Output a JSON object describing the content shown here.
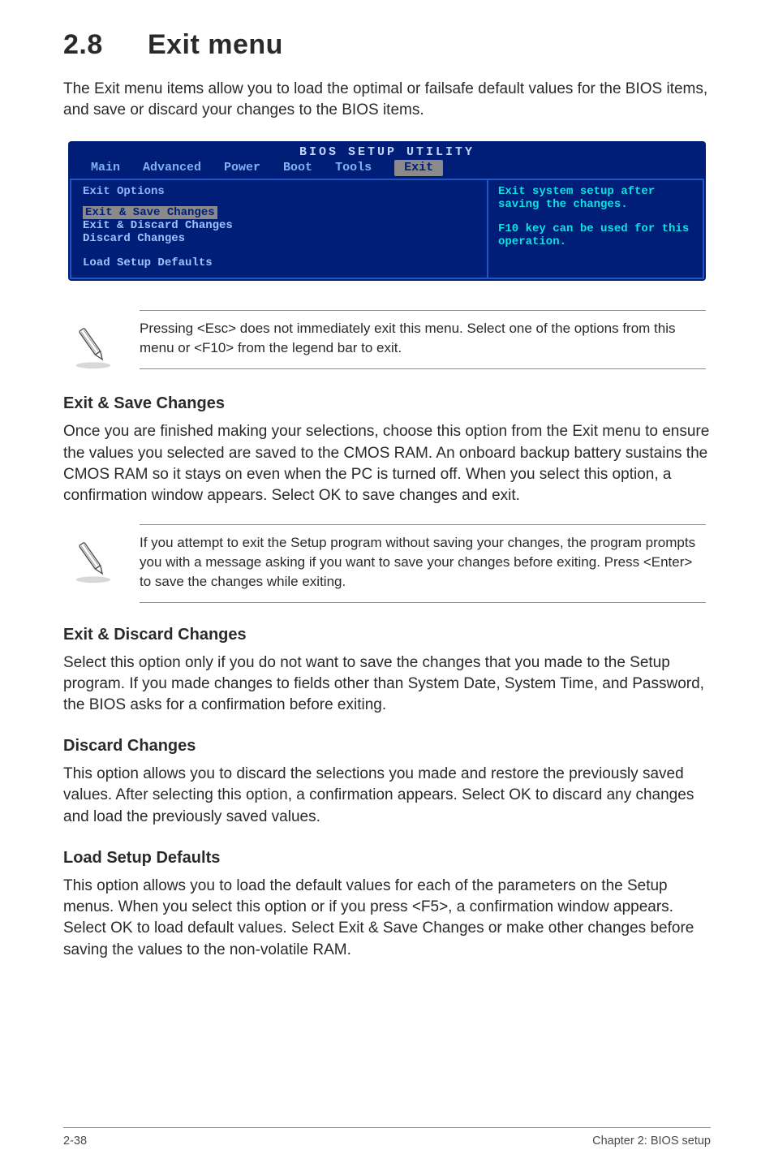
{
  "title": {
    "num": "2.8",
    "text": "Exit menu"
  },
  "intro": "The Exit menu items allow you to load the optimal or failsafe default values for the BIOS items, and save or discard your changes to the BIOS items.",
  "bios": {
    "title": "BIOS SETUP UTILITY",
    "tabs": [
      "Main",
      "Advanced",
      "Power",
      "Boot",
      "Tools",
      "Exit"
    ],
    "active_tab_index": 5,
    "left": {
      "heading": "Exit Options",
      "items": [
        "Exit & Save Changes",
        "Exit & Discard Changes",
        "Discard Changes",
        "",
        "Load Setup Defaults"
      ],
      "selected_index": 0
    },
    "right": {
      "line1": "Exit system setup after saving the changes.",
      "line2": "F10 key can be used for this operation."
    }
  },
  "chart_data": {
    "type": "table",
    "title": "BIOS Exit Menu Options",
    "rows": [
      {
        "option": "Exit & Save Changes",
        "selected": true
      },
      {
        "option": "Exit & Discard Changes",
        "selected": false
      },
      {
        "option": "Discard Changes",
        "selected": false
      },
      {
        "option": "Load Setup Defaults",
        "selected": false
      }
    ],
    "help_panel": [
      "Exit system setup after saving the changes.",
      "F10 key can be used for this operation."
    ]
  },
  "note1": "Pressing <Esc> does not immediately exit this menu. Select one of the options from this menu or <F10> from the legend bar to exit.",
  "sections": {
    "s1": {
      "h": "Exit & Save Changes",
      "p": "Once you are finished making your selections, choose this option from the Exit menu to ensure the values you selected are saved to the CMOS RAM. An onboard backup battery sustains the CMOS RAM so it stays on even when the PC is turned off. When you select this option, a confirmation window appears. Select OK to save changes and exit."
    },
    "s2": {
      "h": "Exit & Discard Changes",
      "p": "Select this option only if you do not want to save the changes that you  made to the Setup program. If you made changes to fields other than System Date, System Time, and Password, the BIOS asks for a confirmation before exiting."
    },
    "s3": {
      "h": "Discard Changes",
      "p": "This option allows you to discard the selections you made and restore the previously saved values. After selecting this option, a confirmation appears. Select OK to discard any changes and load the previously saved values."
    },
    "s4": {
      "h": "Load Setup Defaults",
      "p": "This option allows you to load the default values for each of the parameters on the Setup menus. When you select this option or if you press <F5>, a confirmation window appears. Select OK to load default values. Select Exit & Save Changes or make other changes before saving the values to the non-volatile RAM."
    }
  },
  "note2": " If you attempt to exit the Setup program without saving your changes, the program prompts you with a message asking if you want to save your changes before exiting. Press <Enter>  to save the  changes while exiting.",
  "footer": {
    "left": "2-38",
    "right": "Chapter 2: BIOS setup"
  }
}
